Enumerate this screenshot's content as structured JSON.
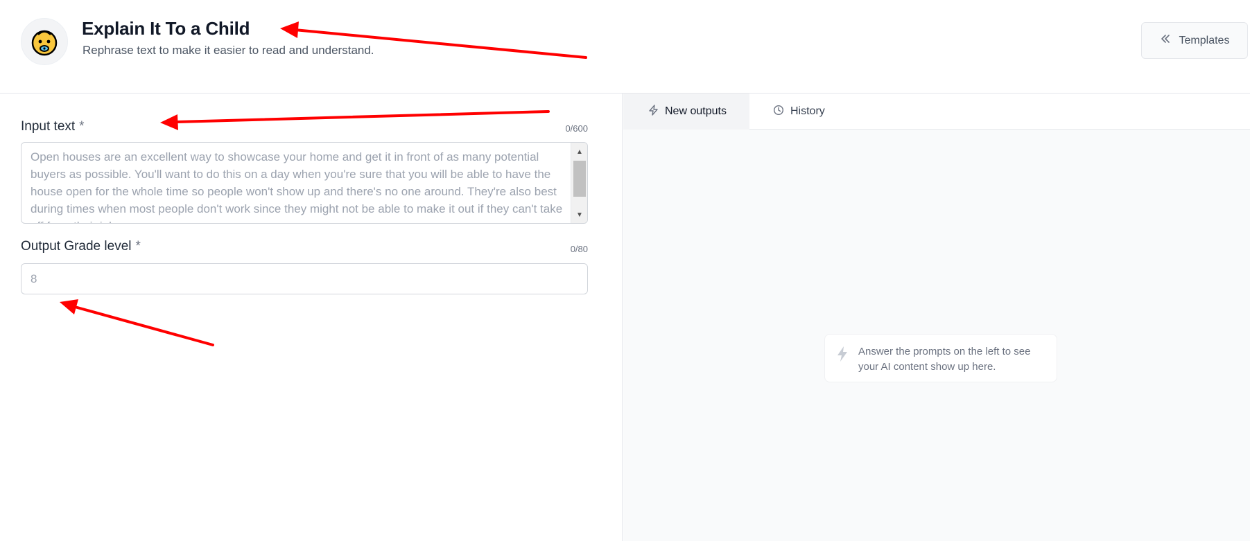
{
  "header": {
    "title": "Explain It To a Child",
    "subtitle": "Rephrase text to make it easier to read and understand.",
    "avatar_icon": "baby-face-icon",
    "templates_label": "Templates",
    "templates_icon": "double-chevron-left-icon"
  },
  "form": {
    "input_text": {
      "label": "Input text",
      "required_marker": "*",
      "counter": "0/600",
      "placeholder": "Open houses are an excellent way to showcase your home and get it in front of as many potential buyers as possible. You'll want to do this on a day when you're sure that you will be able to have the house open for the whole time so people won't show up and there's no one around. They're also best during times when most people don't work since they might not be able to make it out if they can't take off from their job."
    },
    "grade_level": {
      "label": "Output Grade level",
      "required_marker": "*",
      "counter": "0/80",
      "placeholder": "8",
      "value": ""
    }
  },
  "output": {
    "tabs": [
      {
        "label": "New outputs",
        "icon": "lightning-icon",
        "active": true
      },
      {
        "label": "History",
        "icon": "clock-icon",
        "active": false
      }
    ],
    "empty_state": {
      "icon": "lightning-icon",
      "text": "Answer the prompts on the left to see your AI content show up here."
    }
  },
  "colors": {
    "annotation_arrow": "#ff0000",
    "tab_active_bg": "#f3f4f6",
    "panel_bg": "#f9fafb",
    "border": "#e5e7eb"
  }
}
